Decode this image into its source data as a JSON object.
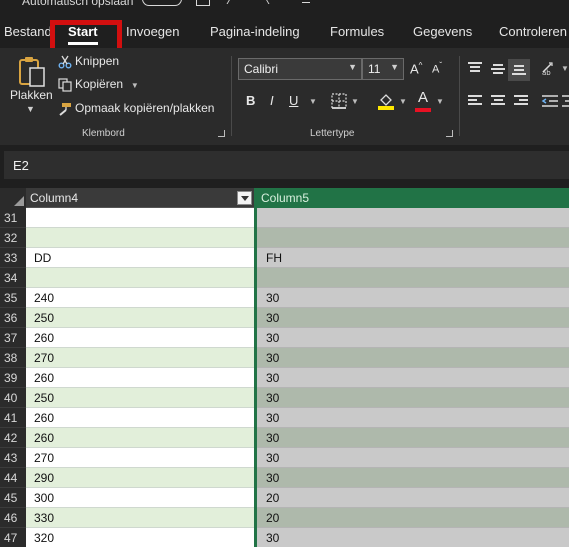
{
  "titlebar": {
    "autosave_label": "Automatisch opslaan"
  },
  "tabs": [
    "Bestand",
    "Start",
    "Invoegen",
    "Pagina-indeling",
    "Formules",
    "Gegevens",
    "Controleren"
  ],
  "ribbon": {
    "clipboard": {
      "paste_label": "Plakken",
      "cut_label": "Knippen",
      "copy_label": "Kopiëren",
      "format_painter_label": "Opmaak kopiëren/plakken",
      "group_label": "Klembord"
    },
    "font": {
      "font_name": "Calibri",
      "font_size": "11",
      "bold": "B",
      "italic": "I",
      "underline": "U",
      "grow": "A",
      "shrink": "A",
      "font_color_glyph": "A",
      "group_label": "Lettertype"
    }
  },
  "formula_bar": {
    "name_box": "E2"
  },
  "grid": {
    "columns": [
      {
        "label": "Column4",
        "selected": false
      },
      {
        "label": "Column5",
        "selected": true
      }
    ],
    "rows": [
      {
        "num": "31",
        "a": "",
        "b": ""
      },
      {
        "num": "32",
        "a": "",
        "b": ""
      },
      {
        "num": "33",
        "a": "DD",
        "b": "FH"
      },
      {
        "num": "34",
        "a": "",
        "b": ""
      },
      {
        "num": "35",
        "a": "240",
        "b": "30"
      },
      {
        "num": "36",
        "a": "250",
        "b": "30"
      },
      {
        "num": "37",
        "a": "260",
        "b": "30"
      },
      {
        "num": "38",
        "a": "270",
        "b": "30"
      },
      {
        "num": "39",
        "a": "260",
        "b": "30"
      },
      {
        "num": "40",
        "a": "250",
        "b": "30"
      },
      {
        "num": "41",
        "a": "260",
        "b": "30"
      },
      {
        "num": "42",
        "a": "260",
        "b": "30"
      },
      {
        "num": "43",
        "a": "270",
        "b": "30"
      },
      {
        "num": "44",
        "a": "290",
        "b": "30"
      },
      {
        "num": "45",
        "a": "300",
        "b": "20"
      },
      {
        "num": "46",
        "a": "330",
        "b": "20"
      },
      {
        "num": "47",
        "a": "320",
        "b": "30"
      }
    ]
  },
  "colors": {
    "header_selected": "#217346",
    "band_light": "#e2efda",
    "band_white": "#ffffff",
    "selected_band_dark": "#aeb9ab",
    "selected_band_gray": "#c9c9c9",
    "highlight_box": "#d20f0f"
  }
}
